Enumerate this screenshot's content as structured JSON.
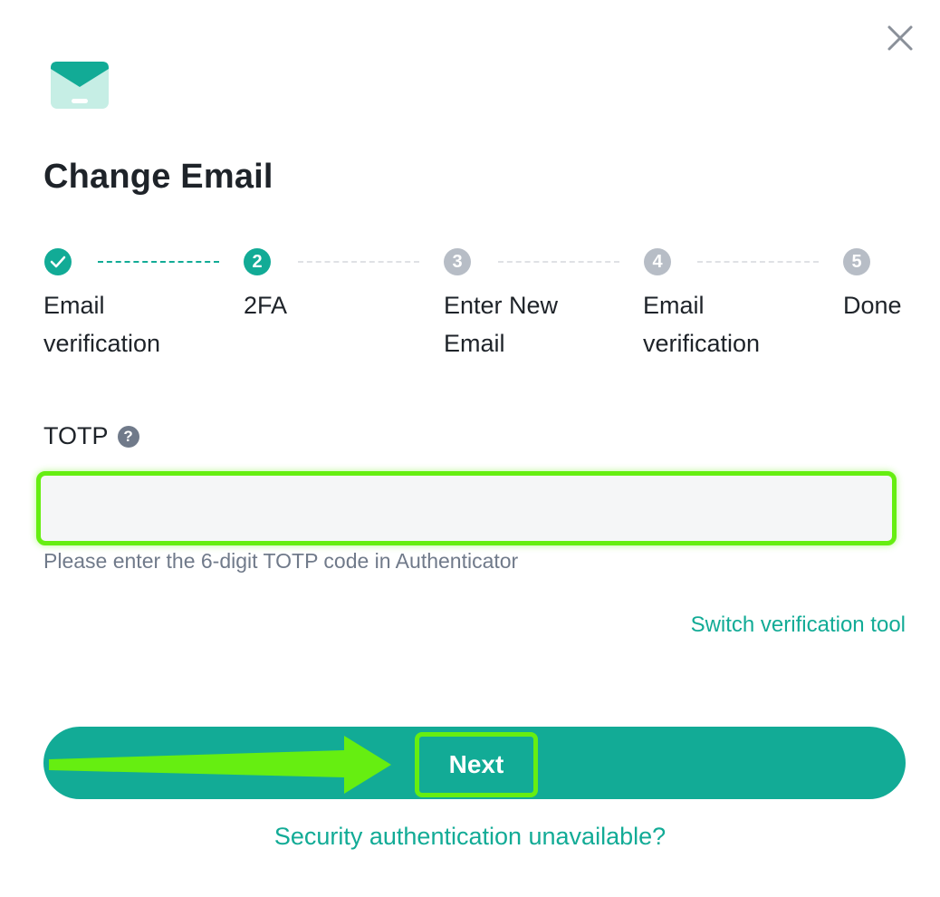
{
  "dialog": {
    "title": "Change Email",
    "close_icon": "close-icon",
    "header_icon": "envelope-icon"
  },
  "steps": [
    {
      "label": "Email verification",
      "number": "1",
      "state": "done"
    },
    {
      "label": "2FA",
      "number": "2",
      "state": "active"
    },
    {
      "label": "Enter New Email",
      "number": "3",
      "state": "pending"
    },
    {
      "label": "Email verification",
      "number": "4",
      "state": "pending"
    },
    {
      "label": "Done",
      "number": "5",
      "state": "pending"
    }
  ],
  "totp": {
    "label": "TOTP",
    "help_icon": "question-circle-icon",
    "value": "",
    "hint": "Please enter the 6-digit TOTP code in Authenticator"
  },
  "links": {
    "switch_tool": "Switch verification tool",
    "unavailable": "Security authentication unavailable?"
  },
  "buttons": {
    "next": "Next"
  },
  "colors": {
    "accent": "#12ab96",
    "pending": "#b7bdc6",
    "highlight": "#66ee11",
    "input_bg": "#f5f6f7",
    "text": "#1e2329",
    "muted": "#707a8a"
  }
}
